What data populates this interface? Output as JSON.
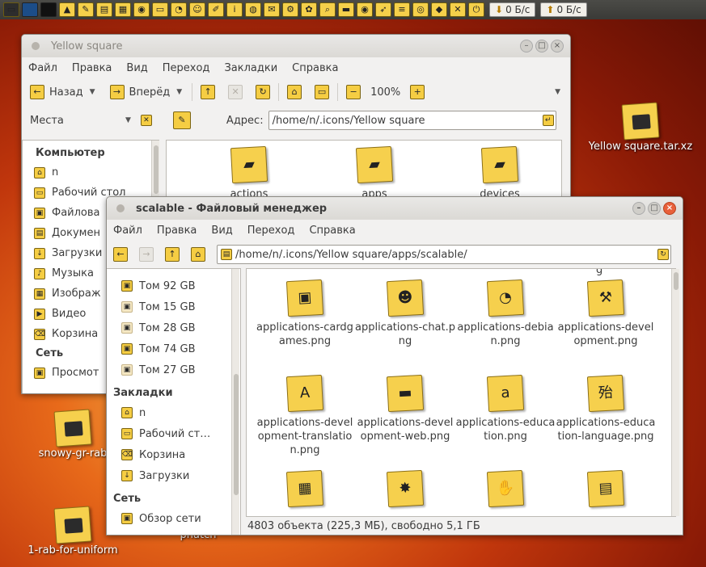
{
  "panel": {
    "net_down": "0 Б/с",
    "net_up": "0 Б/с",
    "net_down_icon": "download-arrow-icon",
    "net_up_icon": "upload-arrow-icon"
  },
  "desktop": [
    {
      "label": "Yellow square.tar.xz",
      "icon": "archive-icon"
    },
    {
      "label": "snowy-gr-rab",
      "icon": "folder-icon"
    },
    {
      "label": "1-rab-for-uniform",
      "icon": "folder-icon"
    },
    {
      "label": "phatch",
      "icon": "folder-icon"
    }
  ],
  "win1": {
    "title": "Yellow square",
    "menu": [
      "Файл",
      "Правка",
      "Вид",
      "Переход",
      "Закладки",
      "Справка"
    ],
    "back": "Назад",
    "forward": "Вперёд",
    "zoom": "100%",
    "places": "Места",
    "address_label": "Адрес:",
    "address": "/home/n/.icons/Yellow square",
    "sidebar": {
      "computer": "Компьютер",
      "items": [
        "n",
        "Рабочий стол",
        "Файлова",
        "Докумен",
        "Загрузки",
        "Музыка",
        "Изображ",
        "Видео",
        "Корзина"
      ],
      "network": "Сеть",
      "net_items": [
        "Просмот"
      ]
    },
    "files": [
      "actions",
      "apps",
      "devices"
    ]
  },
  "win2": {
    "title": "scalable - Файловый менеджер",
    "menu": [
      "Файл",
      "Правка",
      "Вид",
      "Переход",
      "Справка"
    ],
    "address": "/home/n/.icons/Yellow square/apps/scalable/",
    "sidebar": {
      "volumes": [
        "Том 92 GB",
        "Том 15 GB",
        "Том 28 GB",
        "Том 74 GB",
        "Том 27 GB"
      ],
      "bookmarks": "Закладки",
      "bm_items": [
        "n",
        "Рабочий ст…",
        "Корзина",
        "Загрузки"
      ],
      "network": "Сеть",
      "net_items": [
        "Обзор сети"
      ]
    },
    "files": [
      {
        "name": "applications-cardgames.png",
        "icon": "cards-icon"
      },
      {
        "name": "applications-chat.png",
        "icon": "chat-icon"
      },
      {
        "name": "applications-debian.png",
        "icon": "debian-icon"
      },
      {
        "name": "applications-development.png",
        "icon": "developer-icon"
      },
      {
        "name": "applications-development-translation.png",
        "icon": "translate-icon"
      },
      {
        "name": "applications-development-web.png",
        "icon": "web-icon"
      },
      {
        "name": "applications-education.png",
        "icon": "abc-icon"
      },
      {
        "name": "applications-education-language.png",
        "icon": "hieroglyph-icon"
      },
      {
        "name": "",
        "icon": "calculator-icon"
      },
      {
        "name": "",
        "icon": "splat-icon"
      },
      {
        "name": "",
        "icon": "hand-icon"
      },
      {
        "name": "",
        "icon": "book-icon"
      }
    ],
    "partial_label": "g",
    "status": "4803 объекта (225,3 МБ), свободно 5,1 ГБ"
  },
  "colors": {
    "accent": "#f5cd43",
    "close": "#e8603a"
  }
}
